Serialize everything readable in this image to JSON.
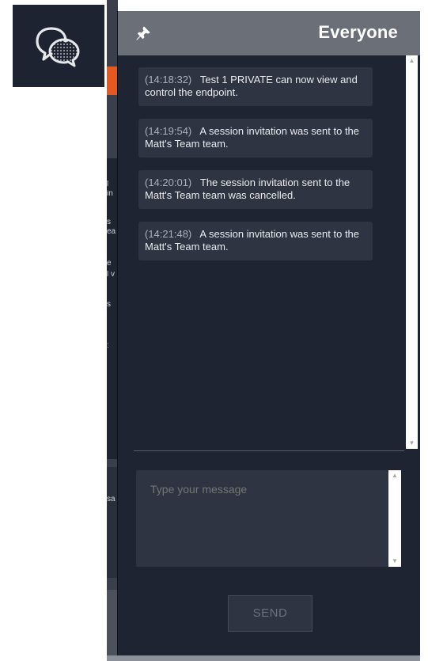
{
  "launcher": {
    "icon": "chat-bubbles-icon"
  },
  "background_fragments": [
    "l",
    "in",
    "s",
    "ea",
    "e",
    "l v",
    "s",
    ":",
    "sa"
  ],
  "header": {
    "title": "Everyone",
    "pin_icon": "pin-icon"
  },
  "messages": [
    {
      "time": "(14:18:32)",
      "text": "Test 1 PRIVATE can now view and control the endpoint."
    },
    {
      "time": "(14:19:54)",
      "text": "A session invitation was sent to the Matt's Team team."
    },
    {
      "time": "(14:20:01)",
      "text": "The session invitation sent to the Matt's Team team was cancelled."
    },
    {
      "time": "(14:21:48)",
      "text": "A session invitation was sent to the Matt's Team team."
    }
  ],
  "composer": {
    "placeholder": "Type your message",
    "send_label": "SEND"
  },
  "colors": {
    "panel_bg": "#1f2433",
    "header_bg": "#6b6f78",
    "bubble_bg": "#2f3442",
    "accent_orange": "#e7581f"
  }
}
